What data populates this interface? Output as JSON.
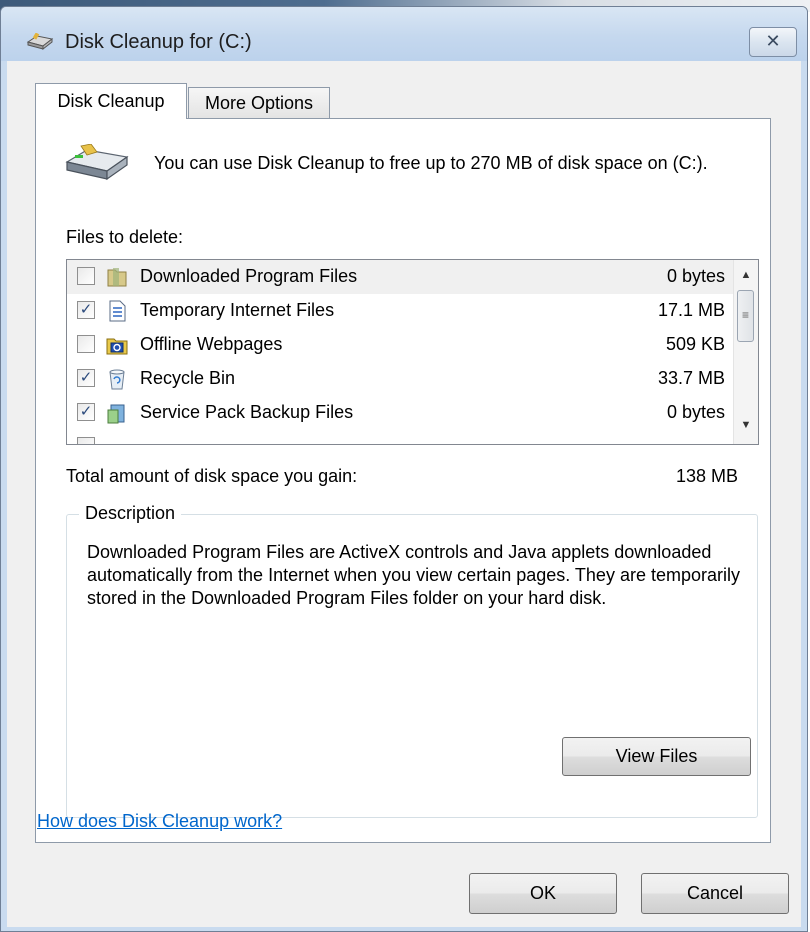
{
  "window": {
    "title": "Disk Cleanup for  (C:)",
    "close_glyph": "✕",
    "title_icon": "disk-cleanup-icon"
  },
  "tabs": [
    {
      "label": "Disk Cleanup",
      "active": true
    },
    {
      "label": "More Options",
      "active": false
    }
  ],
  "main": {
    "intro": "You can use Disk Cleanup to free up to 270 MB of disk space on  (C:).",
    "files_label": "Files to delete:",
    "drive_icon": "drive-cleanup-icon"
  },
  "files": [
    {
      "name": "Downloaded Program Files",
      "size": "0 bytes",
      "checked": false,
      "icon": "folder-icon"
    },
    {
      "name": "Temporary Internet Files",
      "size": "17.1 MB",
      "checked": true,
      "icon": "document-icon"
    },
    {
      "name": "Offline Webpages",
      "size": "509 KB",
      "checked": false,
      "icon": "offline-webpages-icon"
    },
    {
      "name": "Recycle Bin",
      "size": "33.7 MB",
      "checked": true,
      "icon": "recycle-bin-icon"
    },
    {
      "name": "Service Pack Backup Files",
      "size": "0 bytes",
      "checked": true,
      "icon": "service-pack-icon"
    }
  ],
  "total": {
    "label": "Total amount of disk space you gain:",
    "value": "138 MB"
  },
  "description": {
    "legend": "Description",
    "text": "Downloaded Program Files are ActiveX controls and Java applets downloaded automatically from the Internet when you view certain pages. They are temporarily stored in the Downloaded Program Files folder on your hard disk.",
    "view_files_label": "View Files"
  },
  "help_link": "How does Disk Cleanup work?",
  "buttons": {
    "ok": "OK",
    "cancel": "Cancel"
  },
  "colors": {
    "link": "#0066cc",
    "frame": "#c9dbef",
    "check": "#2b4a7c"
  }
}
